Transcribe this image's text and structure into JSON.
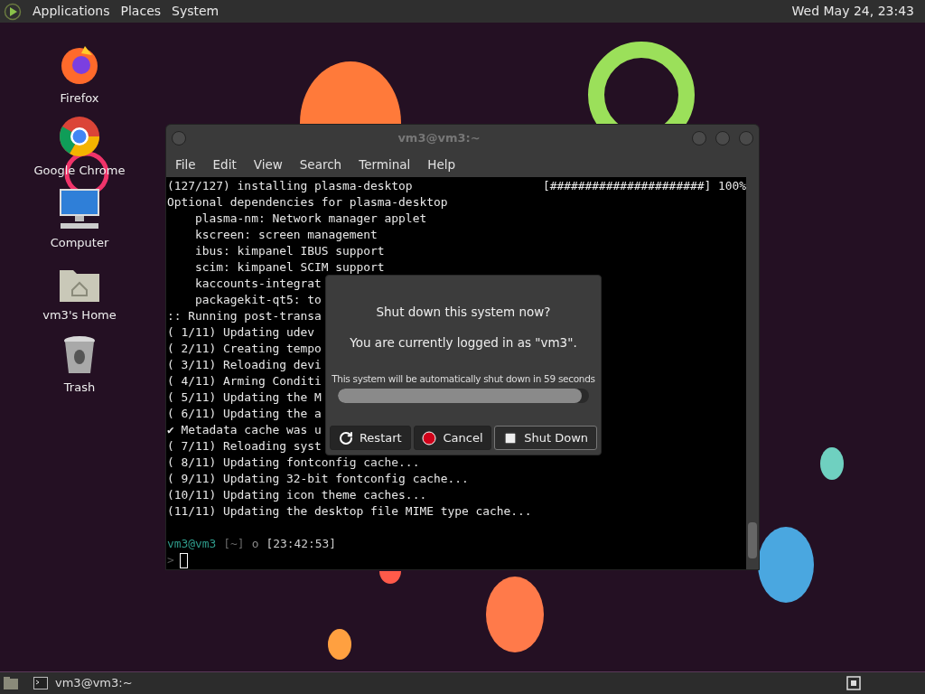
{
  "top_panel": {
    "menus": [
      {
        "label": "Applications"
      },
      {
        "label": "Places"
      },
      {
        "label": "System"
      }
    ],
    "clock": "Wed May 24, 23:43"
  },
  "desktop_icons": [
    {
      "label": "Firefox",
      "kind": "firefox"
    },
    {
      "label": "Google Chrome",
      "kind": "chrome"
    },
    {
      "label": "Computer",
      "kind": "computer"
    },
    {
      "label": "vm3's Home",
      "kind": "home"
    },
    {
      "label": "Trash",
      "kind": "trash"
    }
  ],
  "terminal": {
    "title": "vm3@vm3:~",
    "menu": [
      "File",
      "Edit",
      "View",
      "Search",
      "Terminal",
      "Help"
    ],
    "lines": [
      {
        "text": "(127/127) installing plasma-desktop",
        "progress": "[######################] 100%"
      },
      {
        "text": "Optional dependencies for plasma-desktop"
      },
      {
        "text": "    plasma-nm: Network manager applet"
      },
      {
        "text": "    kscreen: screen management"
      },
      {
        "text": "    ibus: kimpanel IBUS support"
      },
      {
        "text": "    scim: kimpanel SCIM support"
      },
      {
        "text": "    kaccounts-integrat"
      },
      {
        "text": "    packagekit-qt5: to"
      },
      {
        "text": ":: Running post-transa"
      },
      {
        "text": "( 1/11) Updating udev"
      },
      {
        "text": "( 2/11) Creating tempo"
      },
      {
        "text": "( 3/11) Reloading devi"
      },
      {
        "text": "( 4/11) Arming Conditi"
      },
      {
        "text": "( 5/11) Updating the M"
      },
      {
        "text": "( 6/11) Updating the a"
      },
      {
        "text": "✔ Metadata cache was u"
      },
      {
        "text": "( 7/11) Reloading syst"
      },
      {
        "text": "( 8/11) Updating fontconfig cache..."
      },
      {
        "text": "( 9/11) Updating 32-bit fontconfig cache..."
      },
      {
        "text": "(10/11) Updating icon theme caches..."
      },
      {
        "text": "(11/11) Updating the desktop file MIME type cache..."
      }
    ],
    "prompt": {
      "user_host": "vm3@vm3",
      "dir": "[~]",
      "mark": "o",
      "time": "[23:42:53]",
      "input_marker": ">"
    }
  },
  "dialog": {
    "title": "Shut down this system now?",
    "message": "You are currently logged in as \"vm3\".",
    "countdown": "This system will be automatically shut down in 59 seconds",
    "level": 0.97,
    "buttons": [
      {
        "label": "Restart",
        "kind": "restart",
        "focused": false
      },
      {
        "label": "Cancel",
        "kind": "cancel",
        "focused": false
      },
      {
        "label": "Shut Down",
        "kind": "shutdown",
        "focused": true
      }
    ]
  },
  "taskbar": {
    "tasks": [
      {
        "label": "vm3@vm3:~"
      }
    ]
  }
}
